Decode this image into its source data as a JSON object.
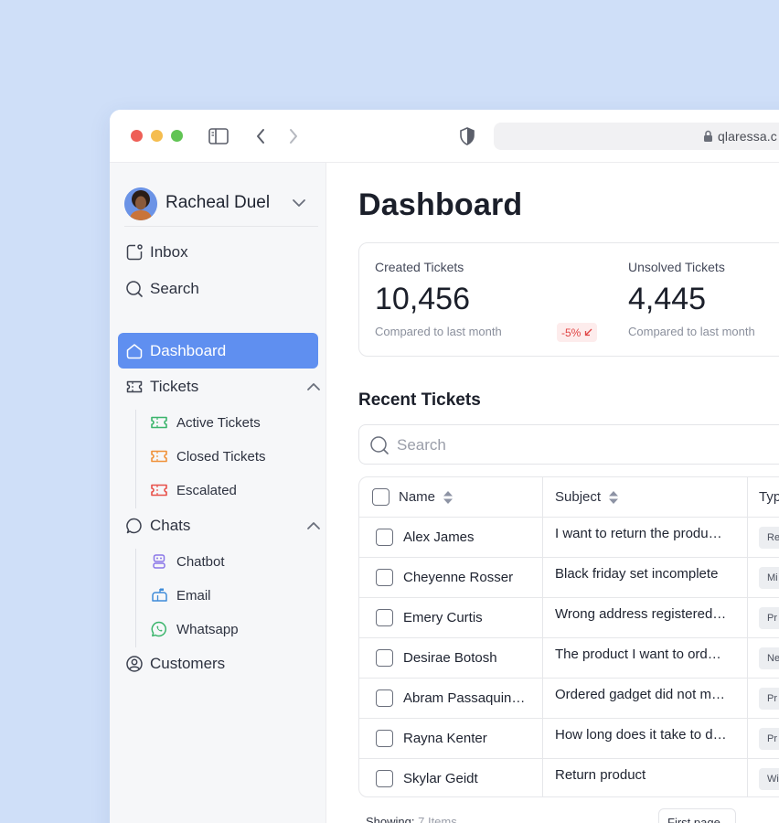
{
  "browser": {
    "url": "qlaressa.c",
    "icons": [
      "sidebar-toggle-icon",
      "chevron-left-icon",
      "chevron-right-icon",
      "shield-icon",
      "lock-icon"
    ]
  },
  "sidebar": {
    "profile_name": "Racheal Duel",
    "top_items": [
      {
        "label": "Inbox",
        "icon": "inbox-icon"
      },
      {
        "label": "Search",
        "icon": "search-icon"
      }
    ],
    "dashboard_label": "Dashboard",
    "tickets": {
      "label": "Tickets",
      "children": [
        {
          "label": "Active Tickets",
          "color": "#3bb56c"
        },
        {
          "label": "Closed Tickets",
          "color": "#f0923a"
        },
        {
          "label": "Escalated",
          "color": "#e8514a"
        }
      ]
    },
    "chats": {
      "label": "Chats",
      "children": [
        {
          "label": "Chatbot",
          "color": "#8a76e8"
        },
        {
          "label": "Email",
          "color": "#3e8bd9"
        },
        {
          "label": "Whatsapp",
          "color": "#3bb56c"
        }
      ]
    },
    "customers_label": "Customers",
    "active_color": "#5f8ff0"
  },
  "main": {
    "title": "Dashboard",
    "stats": [
      {
        "label": "Created Tickets",
        "value": "10,456",
        "compare": "Compared to last month",
        "change": "-5%"
      },
      {
        "label": "Unsolved Tickets",
        "value": "4,445",
        "compare": "Compared to last month"
      }
    ],
    "recent_title": "Recent Tickets",
    "search_placeholder": "Search",
    "table": {
      "columns": [
        "Name",
        "Subject",
        "Typ"
      ],
      "rows": [
        {
          "name": "Alex James",
          "subject": "I want to return the produ…",
          "type": "Re"
        },
        {
          "name": "Cheyenne Rosser",
          "subject": "Black friday set incomplete",
          "type": "Mi"
        },
        {
          "name": "Emery Curtis",
          "subject": "Wrong address registered…",
          "type": "Pr"
        },
        {
          "name": "Desirae Botosh",
          "subject": "The product I want to ord…",
          "type": "Ne"
        },
        {
          "name": "Abram Passaquin…",
          "subject": "Ordered gadget did not m…",
          "type": "Pr"
        },
        {
          "name": "Rayna Kenter",
          "subject": "How long does it take to d…",
          "type": "Pr"
        },
        {
          "name": "Skylar Geidt",
          "subject": "Return product",
          "type": "Wi"
        }
      ]
    },
    "showing_label": "Showing:",
    "showing_count": "7 Items",
    "first_page_label": "First page"
  }
}
